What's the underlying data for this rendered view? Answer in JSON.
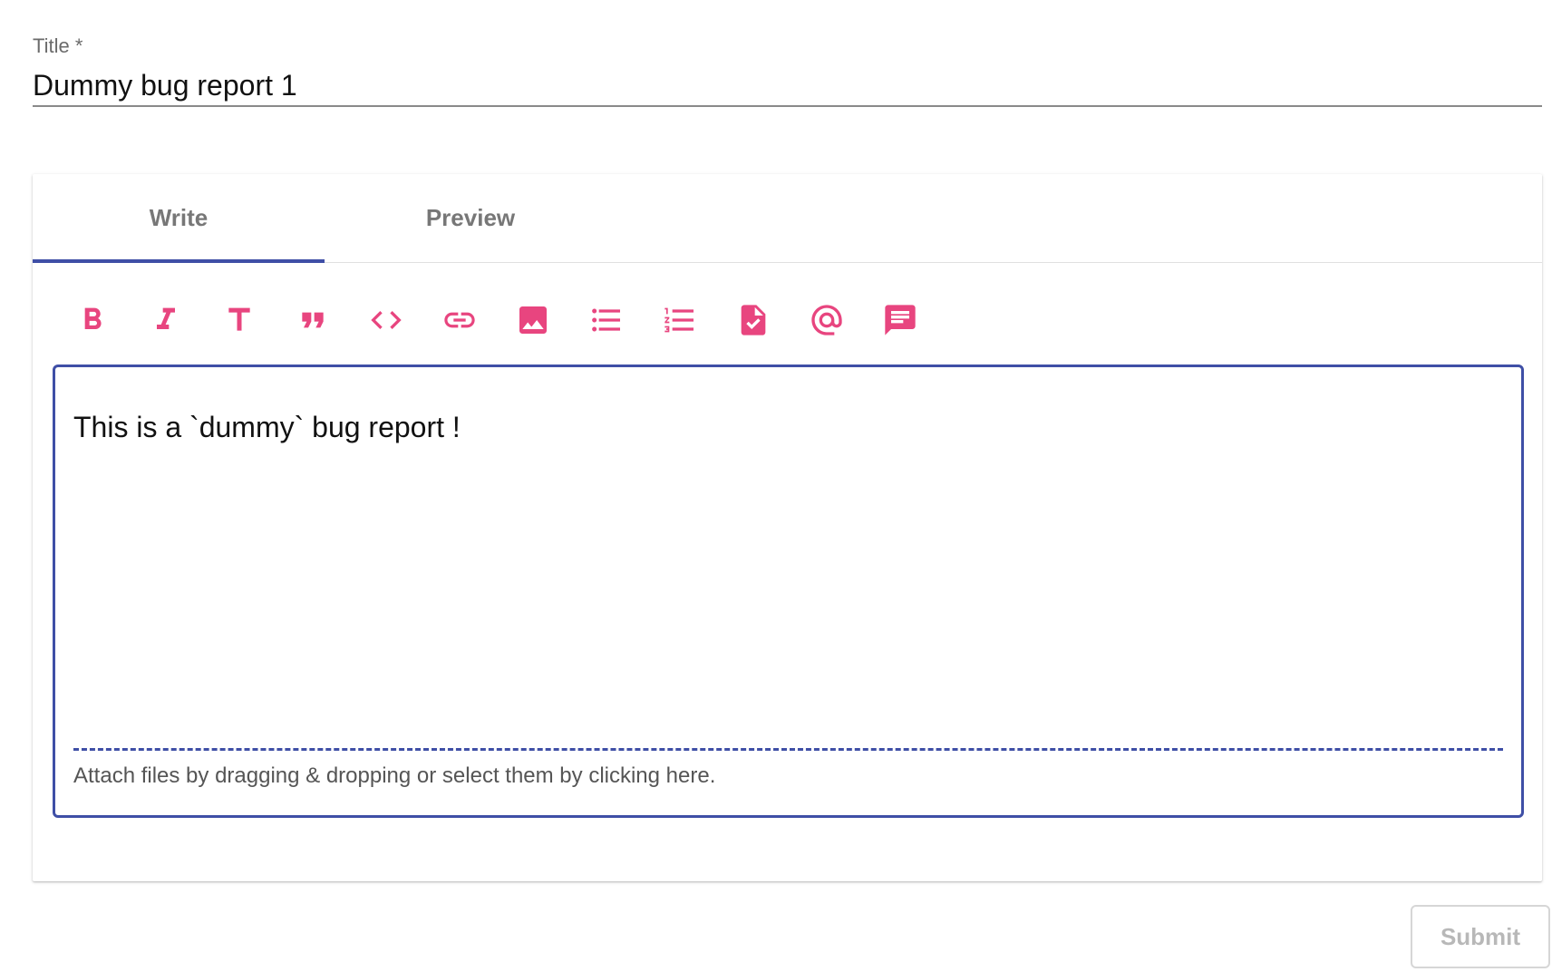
{
  "colors": {
    "accent": "#3f4fa6",
    "icon": "#e8457f"
  },
  "title_field": {
    "label": "Title *",
    "value": "Dummy bug report 1"
  },
  "tabs": [
    {
      "label": "Write",
      "active": true
    },
    {
      "label": "Preview",
      "active": false
    }
  ],
  "toolbar": {
    "icons": [
      "bold-icon",
      "italic-icon",
      "header-icon",
      "quote-icon",
      "code-icon",
      "link-icon",
      "image-icon",
      "bulleted-list-icon",
      "numbered-list-icon",
      "task-list-icon",
      "mention-icon",
      "saved-reply-icon"
    ]
  },
  "editor": {
    "content": "This is a `dummy` bug report !",
    "attach_hint": "Attach files by dragging & dropping or select them by clicking here."
  },
  "submit": {
    "label": "Submit",
    "disabled": true
  }
}
